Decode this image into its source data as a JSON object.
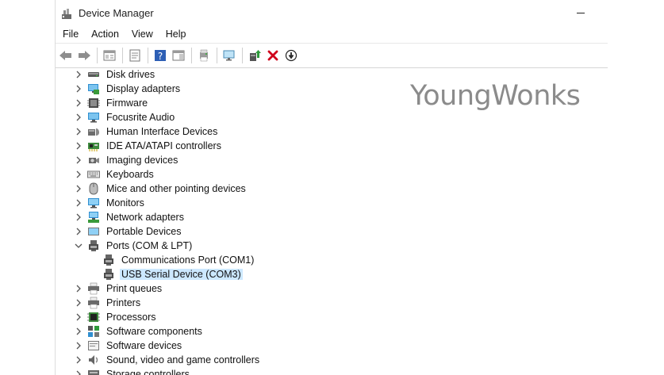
{
  "window": {
    "title": "Device Manager"
  },
  "menu": [
    "File",
    "Action",
    "View",
    "Help"
  ],
  "toolbar": {
    "buttons": [
      {
        "name": "back-arrow-icon"
      },
      {
        "name": "forward-arrow-icon"
      },
      {
        "name": "show-hide-console-tree-icon"
      },
      {
        "name": "properties-icon"
      },
      {
        "name": "help-icon"
      },
      {
        "name": "action-pane-icon"
      },
      {
        "name": "print-icon"
      },
      {
        "name": "scan-hardware-icon"
      },
      {
        "name": "update-driver-icon"
      },
      {
        "name": "uninstall-device-icon"
      },
      {
        "name": "disable-device-icon"
      }
    ]
  },
  "watermark": "YoungWonks",
  "tree": {
    "items": [
      {
        "label": "Disk drives",
        "icon": "disk-drive-icon",
        "level": 1,
        "state": "collapsed"
      },
      {
        "label": "Display adapters",
        "icon": "display-adapter-icon",
        "level": 1,
        "state": "collapsed"
      },
      {
        "label": "Firmware",
        "icon": "firmware-icon",
        "level": 1,
        "state": "collapsed"
      },
      {
        "label": "Focusrite Audio",
        "icon": "audio-monitor-icon",
        "level": 1,
        "state": "collapsed"
      },
      {
        "label": "Human Interface Devices",
        "icon": "hid-icon",
        "level": 1,
        "state": "collapsed"
      },
      {
        "label": "IDE ATA/ATAPI controllers",
        "icon": "ide-controller-icon",
        "level": 1,
        "state": "collapsed"
      },
      {
        "label": "Imaging devices",
        "icon": "camera-icon",
        "level": 1,
        "state": "collapsed"
      },
      {
        "label": "Keyboards",
        "icon": "keyboard-icon",
        "level": 1,
        "state": "collapsed"
      },
      {
        "label": "Mice and other pointing devices",
        "icon": "mouse-icon",
        "level": 1,
        "state": "collapsed"
      },
      {
        "label": "Monitors",
        "icon": "monitor-icon",
        "level": 1,
        "state": "collapsed"
      },
      {
        "label": "Network adapters",
        "icon": "network-adapter-icon",
        "level": 1,
        "state": "collapsed"
      },
      {
        "label": "Portable Devices",
        "icon": "portable-device-icon",
        "level": 1,
        "state": "collapsed"
      },
      {
        "label": "Ports (COM & LPT)",
        "icon": "port-icon",
        "level": 1,
        "state": "expanded"
      },
      {
        "label": "Communications Port (COM1)",
        "icon": "port-icon",
        "level": 2,
        "state": "leaf"
      },
      {
        "label": "USB Serial Device (COM3)",
        "icon": "port-icon",
        "level": 2,
        "state": "leaf",
        "selected": true
      },
      {
        "label": "Print queues",
        "icon": "printer-icon",
        "level": 1,
        "state": "collapsed"
      },
      {
        "label": "Printers",
        "icon": "printer-icon",
        "level": 1,
        "state": "collapsed"
      },
      {
        "label": "Processors",
        "icon": "processor-icon",
        "level": 1,
        "state": "collapsed"
      },
      {
        "label": "Software components",
        "icon": "software-component-icon",
        "level": 1,
        "state": "collapsed"
      },
      {
        "label": "Software devices",
        "icon": "software-device-icon",
        "level": 1,
        "state": "collapsed"
      },
      {
        "label": "Sound, video and game controllers",
        "icon": "speaker-icon",
        "level": 1,
        "state": "collapsed"
      },
      {
        "label": "Storage controllers",
        "icon": "storage-controller-icon",
        "level": 1,
        "state": "collapsed"
      }
    ]
  },
  "colors": {
    "selection": "#cce8ff",
    "accent": "#0078d4",
    "uninstall_red": "#d0021b"
  }
}
